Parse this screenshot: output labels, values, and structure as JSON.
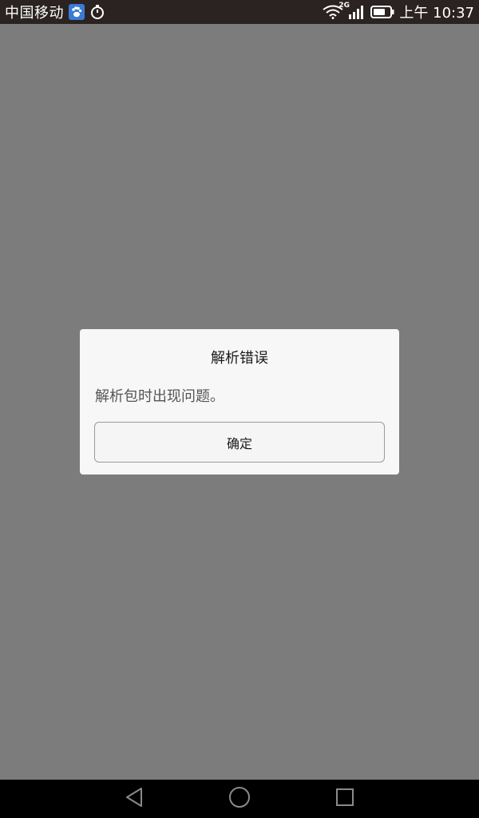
{
  "status_bar": {
    "carrier": "中国移动",
    "network_type": "2G",
    "time": "上午 10:37",
    "icons": [
      "baidu-icon",
      "timer-icon",
      "wifi-icon",
      "signal-icon",
      "battery-icon"
    ]
  },
  "dialog": {
    "title": "解析错误",
    "message": "解析包时出现问题。",
    "confirm_label": "确定"
  },
  "nav_bar": {
    "icons": [
      "back-icon",
      "home-icon",
      "recent-apps-icon"
    ]
  },
  "colors": {
    "overlay": "#7c7c7c",
    "status_bar": "#2a2321",
    "dialog_bg": "#f7f7f7",
    "nav_bar": "#000000"
  }
}
